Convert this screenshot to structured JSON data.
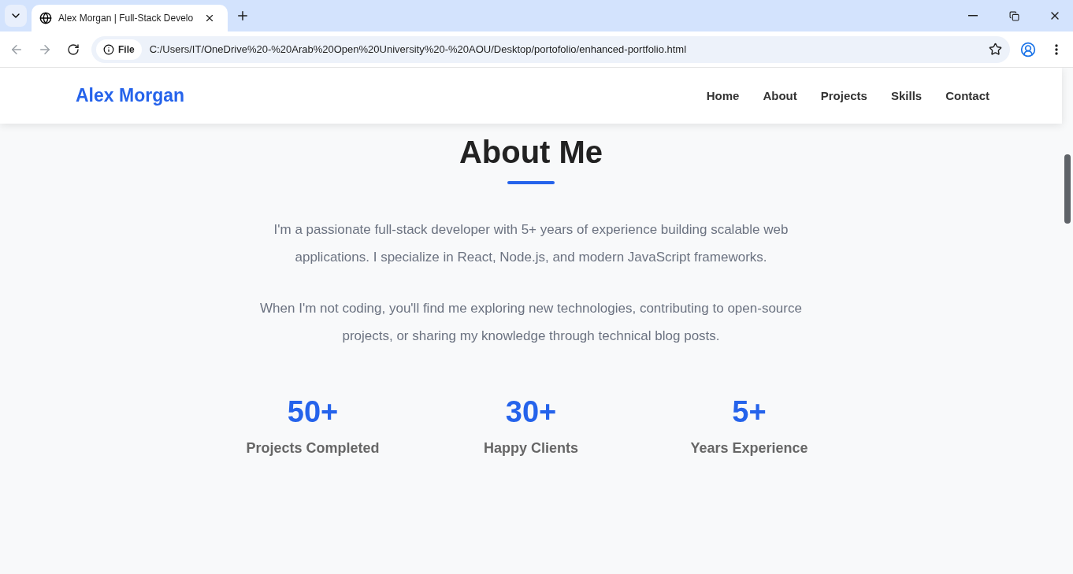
{
  "browser": {
    "tab_title": "Alex Morgan | Full-Stack Develo",
    "address_label": "File",
    "url": "C:/Users/IT/OneDrive%20-%20Arab%20Open%20University%20-%20AOU/Desktop/portofolio/enhanced-portfolio.html"
  },
  "header": {
    "logo": "Alex Morgan",
    "nav": [
      "Home",
      "About",
      "Projects",
      "Skills",
      "Contact"
    ]
  },
  "about": {
    "title": "About Me",
    "paragraphs": [
      "I'm a passionate full-stack developer with 5+ years of experience building scalable web applications. I specialize in React, Node.js, and modern JavaScript frameworks.",
      "When I'm not coding, you'll find me exploring new technologies, contributing to open-source projects, or sharing my knowledge through technical blog posts."
    ],
    "stats": [
      {
        "value": "50+",
        "label": "Projects Completed"
      },
      {
        "value": "30+",
        "label": "Happy Clients"
      },
      {
        "value": "5+",
        "label": "Years Experience"
      }
    ]
  }
}
